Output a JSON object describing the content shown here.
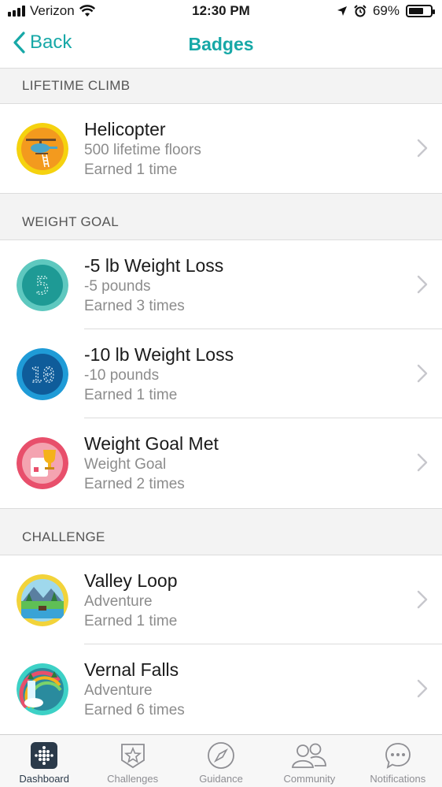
{
  "status_bar": {
    "carrier": "Verizon",
    "time": "12:30 PM",
    "battery_text": "69%",
    "battery_level": 0.69
  },
  "nav": {
    "back_label": "Back",
    "title": "Badges"
  },
  "sections": [
    {
      "header": "LIFETIME CLIMB",
      "items": [
        {
          "title": "Helicopter",
          "subtitle": "500 lifetime floors",
          "earned": "Earned 1 time",
          "icon": "helicopter-badge-icon"
        }
      ]
    },
    {
      "header": "WEIGHT GOAL",
      "items": [
        {
          "title": "-5 lb Weight Loss",
          "subtitle": "-5 pounds",
          "earned": "Earned 3 times",
          "icon": "weight-loss-5-badge-icon",
          "digit": "5"
        },
        {
          "title": "-10 lb Weight Loss",
          "subtitle": "-10 pounds",
          "earned": "Earned 1 time",
          "icon": "weight-loss-10-badge-icon",
          "digit": "10"
        },
        {
          "title": "Weight Goal Met",
          "subtitle": "Weight Goal",
          "earned": "Earned 2 times",
          "icon": "trophy-badge-icon"
        }
      ]
    },
    {
      "header": "CHALLENGE",
      "items": [
        {
          "title": "Valley Loop",
          "subtitle": "Adventure",
          "earned": "Earned 1 time",
          "icon": "valley-loop-badge-icon"
        },
        {
          "title": "Vernal Falls",
          "subtitle": "Adventure",
          "earned": "Earned 6 times",
          "icon": "vernal-falls-badge-icon"
        }
      ]
    }
  ],
  "tabs": [
    {
      "label": "Dashboard",
      "icon": "dashboard-icon",
      "active": true
    },
    {
      "label": "Challenges",
      "icon": "challenges-star-icon",
      "active": false
    },
    {
      "label": "Guidance",
      "icon": "compass-icon",
      "active": false
    },
    {
      "label": "Community",
      "icon": "people-icon",
      "active": false
    },
    {
      "label": "Notifications",
      "icon": "chat-bubble-icon",
      "active": false
    }
  ],
  "colors": {
    "accent": "#17a8a7",
    "section_bg": "#f3f3f3",
    "subtitle": "#8c8c8c"
  }
}
